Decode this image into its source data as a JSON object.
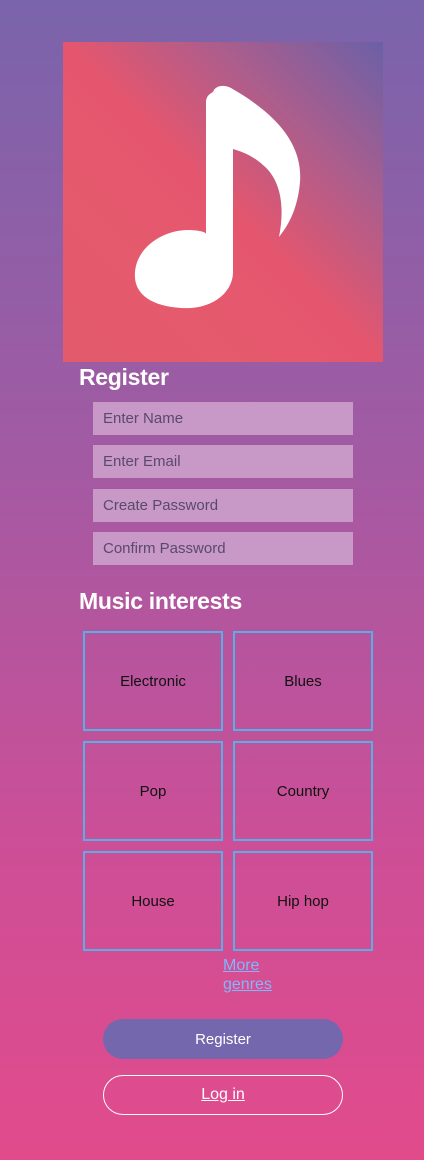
{
  "logo": {
    "icon": "music-note-icon"
  },
  "register": {
    "title": "Register",
    "name_placeholder": "Enter Name",
    "email_placeholder": "Enter Email",
    "password_placeholder": "Create Password",
    "confirm_placeholder": "Confirm Password"
  },
  "interests": {
    "title": "Music interests",
    "genres": [
      "Electronic",
      "Blues",
      "Pop",
      "Country",
      "House",
      "Hip hop"
    ],
    "more_label": "More genres"
  },
  "actions": {
    "register_label": "Register",
    "login_label": "Log in"
  },
  "colors": {
    "genre_border": "#5aaee8",
    "register_button": "#7467ad",
    "link": "#7fb8ff"
  }
}
